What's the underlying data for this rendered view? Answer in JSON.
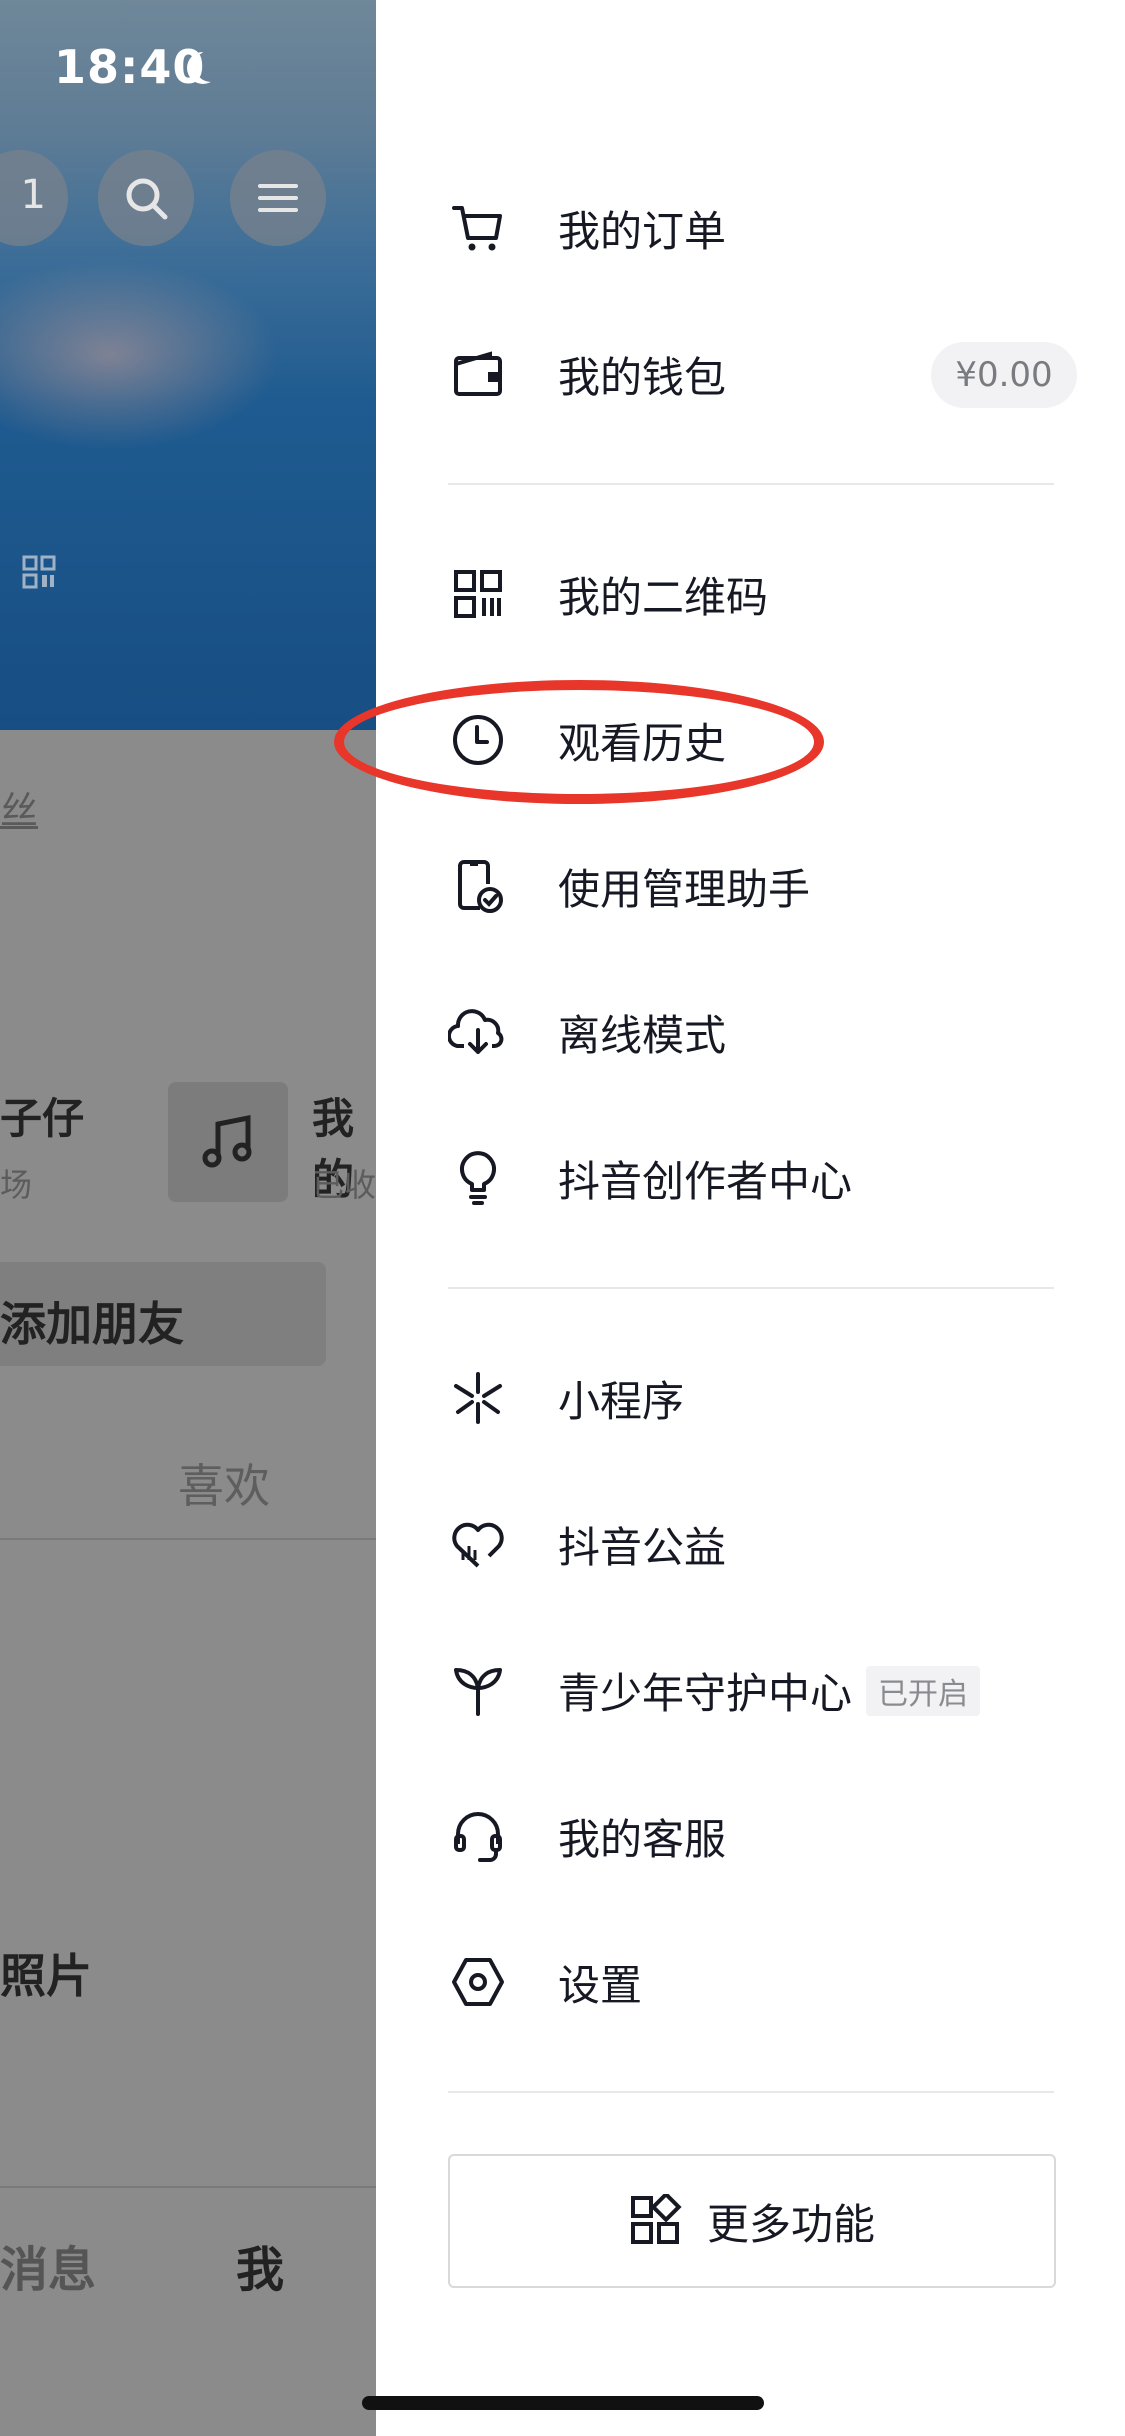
{
  "status_bar": {
    "time": "18:40"
  },
  "profile_bg": {
    "friend_count": "1",
    "fans_label": "丝",
    "fan_item_name": "子仔",
    "fan_item_sub": "场",
    "music_item_name": "我的",
    "music_item_sub": "已收",
    "add_friend": "添加朋友",
    "like_tab": "喜欢",
    "photo_label": "照片",
    "tab_messages": "消息",
    "tab_me": "我"
  },
  "menu": {
    "orders": "我的订单",
    "wallet": "我的钱包",
    "wallet_balance": "¥0.00",
    "qrcode": "我的二维码",
    "history": "观看历史",
    "usage_manager": "使用管理助手",
    "offline": "离线模式",
    "creator_center": "抖音创作者中心",
    "mini_program": "小程序",
    "charity": "抖音公益",
    "youth_center": "青少年守护中心",
    "youth_badge": "已开启",
    "customer_service": "我的客服",
    "settings": "设置",
    "more_features": "更多功能"
  },
  "colors": {
    "highlight": "#e8362b",
    "text": "#161823"
  }
}
